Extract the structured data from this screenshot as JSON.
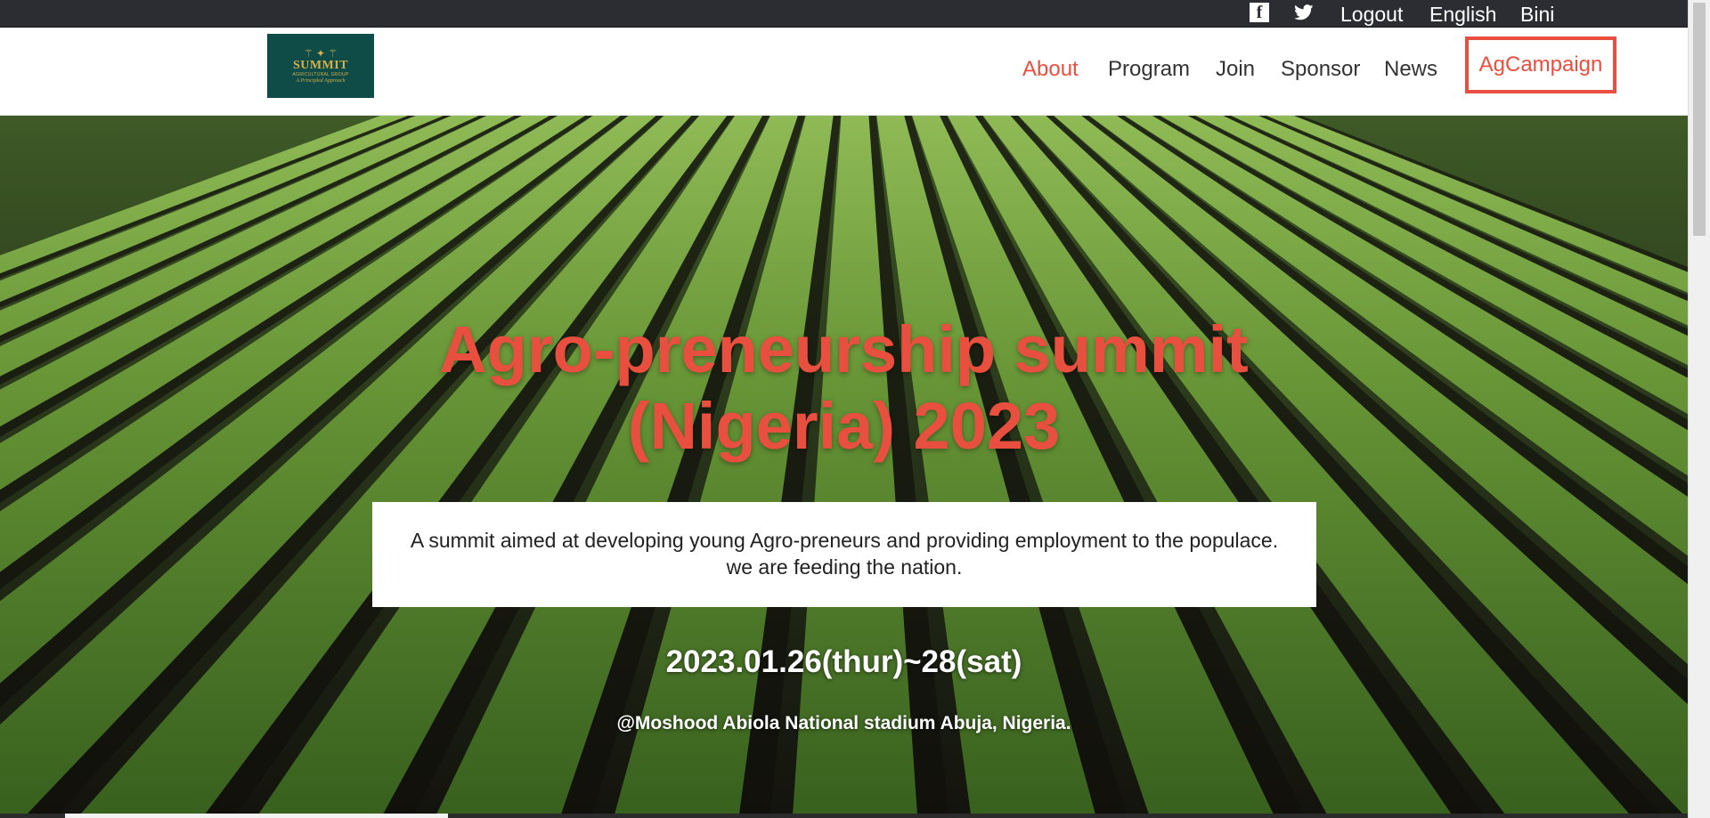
{
  "topbar": {
    "facebook_icon": "facebook-icon",
    "twitter_icon": "twitter-icon",
    "links": [
      "Logout",
      "English",
      "Bini"
    ]
  },
  "header": {
    "logo": {
      "brand": "SUMMIT",
      "subtitle": "AGRICULTURAL GROUP",
      "tagline": "A Principled Approach"
    },
    "nav": {
      "items": [
        "About",
        "Program",
        "Join",
        "Sponsor",
        "News"
      ],
      "active": "About",
      "campaign_label": "AgCampaign"
    }
  },
  "hero": {
    "title_line1": "Agro-preneurship summit",
    "title_line2": "(Nigeria) 2023",
    "description_line1": "A summit aimed at developing young Agro-preneurs and providing employment to the populace.",
    "description_line2": "we are feeding the nation.",
    "date": "2023.01.26(thur)~28(sat)",
    "venue": "@Moshood Abiola National stadium Abuja, Nigeria."
  },
  "colors": {
    "accent": "#e94f3f",
    "topbar_bg": "#2c2d33",
    "logo_bg": "#0f4c47",
    "logo_gold": "#d7b04a"
  }
}
